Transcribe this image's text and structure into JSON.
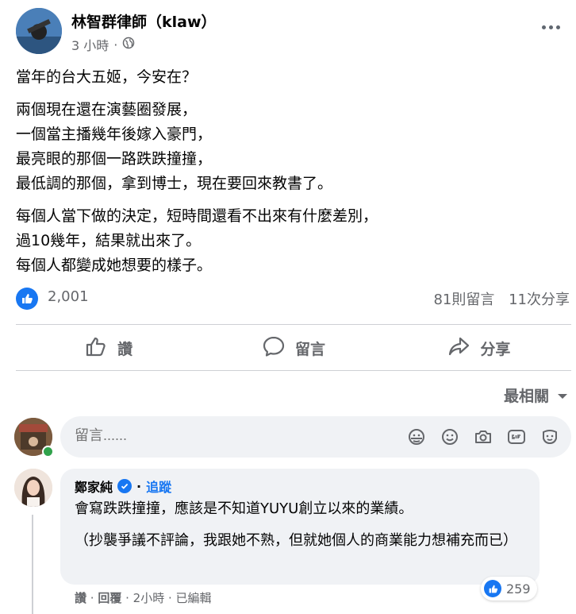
{
  "post": {
    "author": "林智群律師（klaw）",
    "time": "3 小時",
    "dot": "·",
    "paragraphs": [
      [
        "當年的台大五姬，今安在？"
      ],
      [
        "兩個現在還在演藝圈發展，",
        "一個當主播幾年後嫁入豪門，",
        "最亮眼的那個一路跌跌撞撞，",
        "最低調的那個，拿到博士，現在要回來教書了。"
      ],
      [
        "每個人當下做的決定，短時間還看不出來有什麼差別，",
        "過10幾年，結果就出來了。",
        "每個人都變成她想要的樣子。"
      ]
    ]
  },
  "stats": {
    "likes": "2,001",
    "comments": "81則留言",
    "shares": "11次分享"
  },
  "actions": {
    "like": "讚",
    "comment": "留言",
    "share": "分享"
  },
  "sort_label": "最相關",
  "composer": {
    "placeholder": "留言......"
  },
  "comment": {
    "author": "鄭家純",
    "dot": "·",
    "follow": "追蹤",
    "paragraphs": [
      "會寫跌跌撞撞，應該是不知道YUYU創立以來的業績。",
      "（抄襲爭議不評論，我跟她不熟，但就她個人的商業能力想補充而已）"
    ],
    "reaction_count": "259",
    "footer": {
      "like": "讚",
      "sep1": " · ",
      "reply": "回覆",
      "sep2": " · ",
      "time": "2小時",
      "sep3": " · ",
      "edited": "已編輯"
    }
  },
  "colors": {
    "accent": "#1877f2",
    "secondary_text": "#65676b",
    "bubble": "#f0f2f5",
    "online": "#31a24c"
  },
  "icons": [
    "globe-icon",
    "more-icon",
    "like-icon",
    "comment-icon",
    "share-icon",
    "caret-down-icon",
    "sticker-icon",
    "emoji-icon",
    "camera-icon",
    "gif-icon",
    "avatar-sticker-icon",
    "verified-icon"
  ]
}
